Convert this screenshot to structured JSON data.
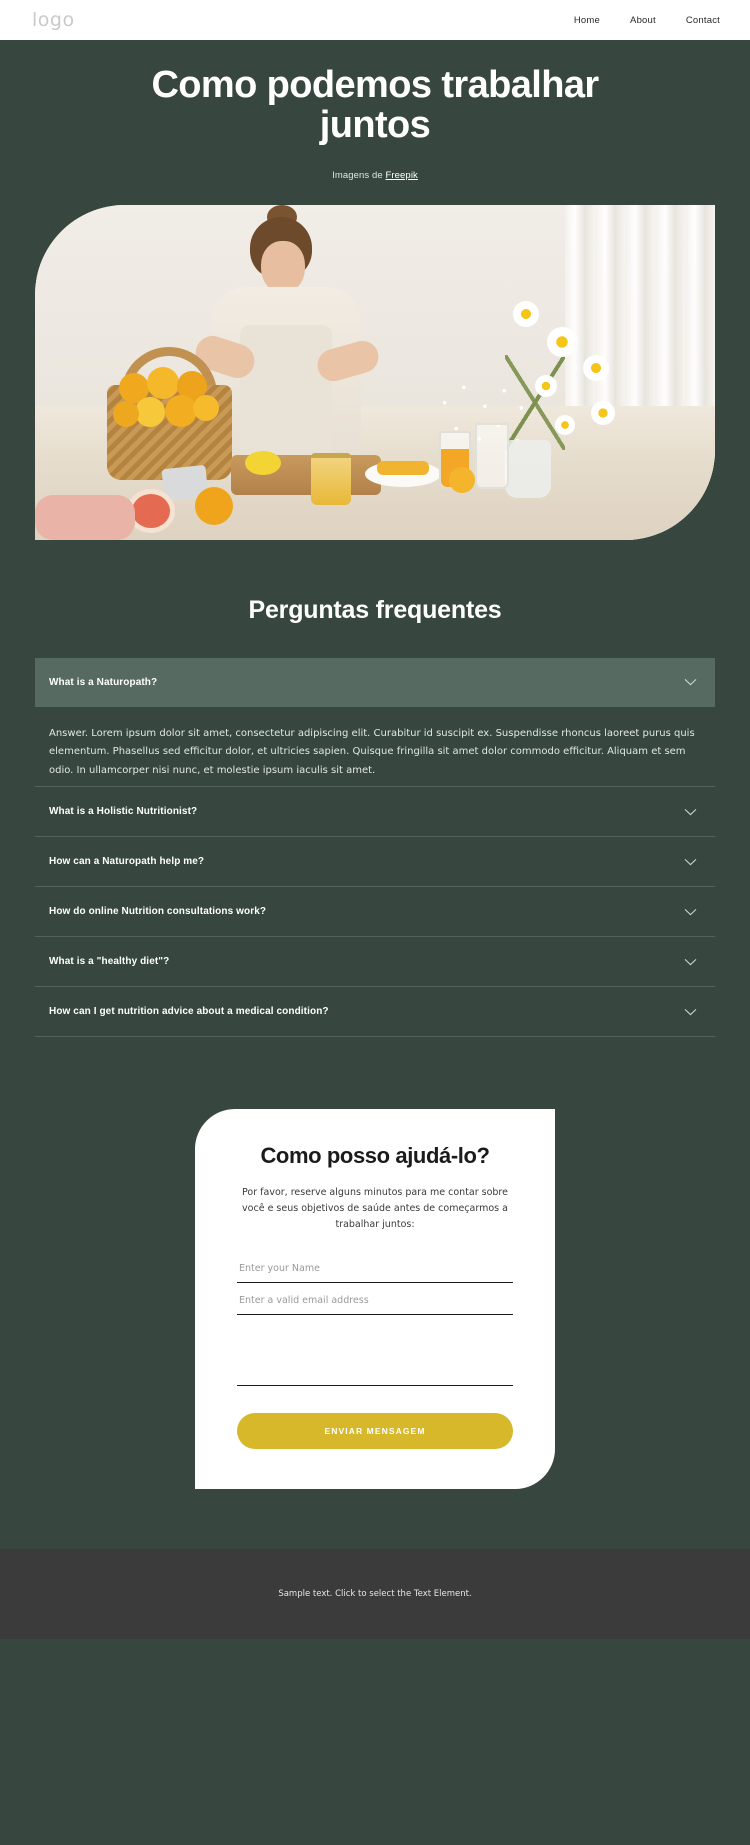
{
  "theme": {
    "page_bg": "#37473f",
    "header_bg": "#ffffff",
    "accent_button": "#d6b82a",
    "faq_open_bg": "#566a61",
    "footer_bg": "#3b3b3b"
  },
  "header": {
    "logo": "logo",
    "nav": [
      {
        "label": "Home"
      },
      {
        "label": "About"
      },
      {
        "label": "Contact"
      }
    ]
  },
  "hero": {
    "title": "Como podemos trabalhar juntos",
    "credit_prefix": "Imagens de ",
    "credit_link": "Freepik"
  },
  "faq": {
    "title": "Perguntas frequentes",
    "items": [
      {
        "question": "What is a Naturopath?",
        "open": true,
        "answer": "Answer. Lorem ipsum dolor sit amet, consectetur adipiscing elit. Curabitur id suscipit ex. Suspendisse rhoncus laoreet purus quis elementum. Phasellus sed efficitur dolor, et ultricies sapien. Quisque fringilla sit amet dolor commodo efficitur. Aliquam et sem odio. In ullamcorper nisi nunc, et molestie ipsum iaculis sit amet."
      },
      {
        "question": "What is a Holistic Nutritionist?",
        "open": false,
        "answer": ""
      },
      {
        "question": "How can a Naturopath help me?",
        "open": false,
        "answer": ""
      },
      {
        "question": "How do online Nutrition consultations work?",
        "open": false,
        "answer": ""
      },
      {
        "question": "What is a \"healthy diet\"?",
        "open": false,
        "answer": ""
      },
      {
        "question": "How can I get nutrition advice about a medical condition?",
        "open": false,
        "answer": ""
      }
    ],
    "chevron_icon": "chevron-down-icon"
  },
  "contact": {
    "title": "Como posso ajudá-lo?",
    "subtitle": "Por favor, reserve alguns minutos para me contar sobre você e seus objetivos de saúde antes de começarmos a trabalhar juntos:",
    "name_placeholder": "Enter your Name",
    "name_value": "",
    "email_placeholder": "Enter a valid email address",
    "email_value": "",
    "message_placeholder": "",
    "message_value": "",
    "submit_label": "ENVIAR MENSAGEM"
  },
  "footer": {
    "text": "Sample text. Click to select the Text Element."
  }
}
